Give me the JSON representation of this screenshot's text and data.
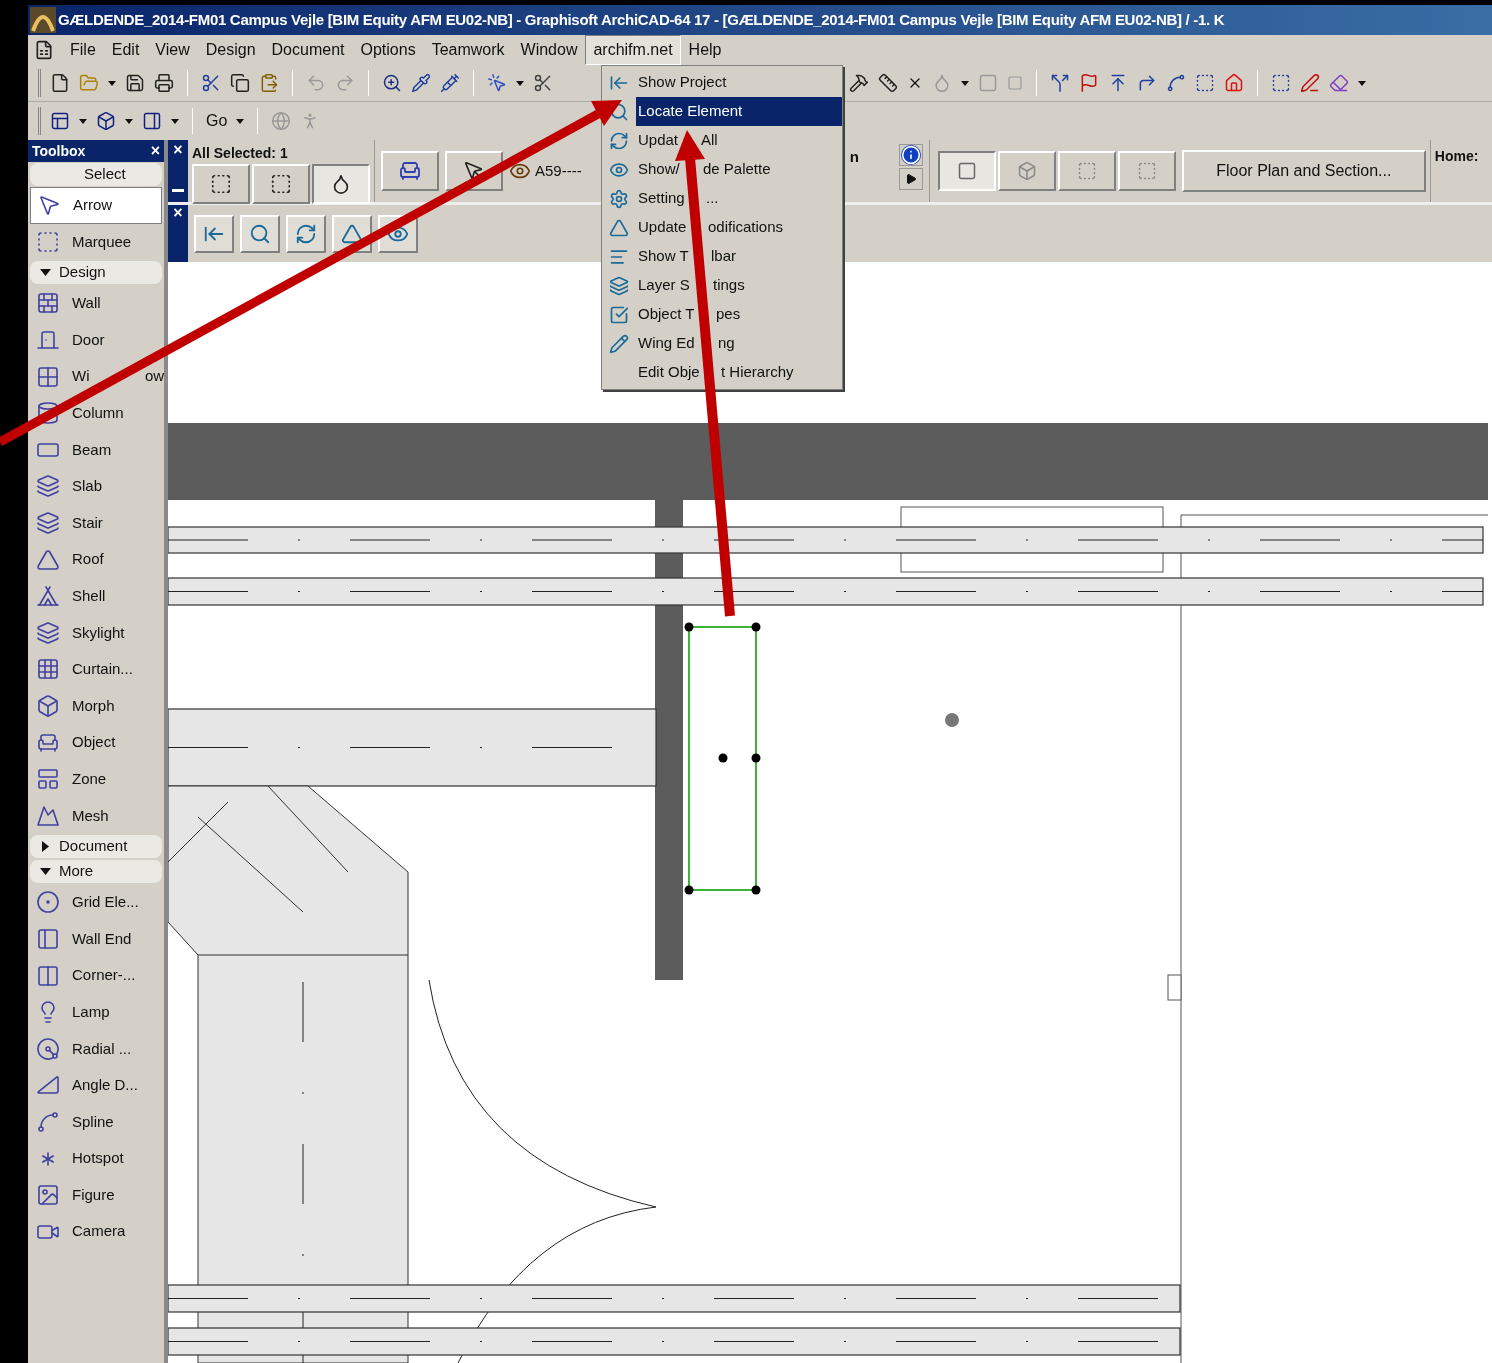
{
  "window": {
    "title": "GÆLDENDE_2014-FM01 Campus Vejle  [BIM Equity AFM EU02-NB] - Graphisoft ArchiCAD-64 17 - [GÆLDENDE_2014-FM01 Campus Vejle  [BIM Equity AFM EU02-NB] / -1. K"
  },
  "menu_bar": [
    {
      "label": "File",
      "selected": false
    },
    {
      "label": "Edit",
      "selected": false
    },
    {
      "label": "View",
      "selected": false
    },
    {
      "label": "Design",
      "selected": false
    },
    {
      "label": "Document",
      "selected": false
    },
    {
      "label": "Options",
      "selected": false
    },
    {
      "label": "Teamwork",
      "selected": false
    },
    {
      "label": "Window",
      "selected": false
    },
    {
      "label": "archifm.net",
      "selected": true
    },
    {
      "label": "Help",
      "selected": false
    }
  ],
  "toolbar": {
    "go_label": "Go"
  },
  "dropdown_menu": [
    {
      "label": "Show Project",
      "selected": false
    },
    {
      "label": "Locate Element",
      "selected": true
    },
    {
      "label_parts": [
        "Updat",
        "All"
      ],
      "selected": false
    },
    {
      "label_parts": [
        "Show/",
        "de Palette"
      ],
      "selected": false
    },
    {
      "label_parts": [
        "Setting",
        "..."
      ],
      "selected": false
    },
    {
      "label_parts": [
        "Update",
        "odifications"
      ],
      "selected": false
    },
    {
      "label_parts": [
        "Show T",
        "lbar"
      ],
      "selected": false
    },
    {
      "label_parts": [
        "Layer S",
        "tings"
      ],
      "selected": false
    },
    {
      "label_parts": [
        "Object T",
        "pes"
      ],
      "selected": false
    },
    {
      "label_parts": [
        "Wing Ed",
        "ng"
      ],
      "selected": false
    },
    {
      "label_parts": [
        "Edit Obje",
        "t Hierarchy"
      ],
      "selected": false
    }
  ],
  "toolbox": {
    "title": "Toolbox",
    "close": "×",
    "sections": [
      {
        "label": "Select",
        "kind": "plain",
        "items": [
          {
            "label": "Arrow",
            "selected": true
          },
          {
            "label": "Marquee",
            "selected": false
          }
        ]
      },
      {
        "label": "Design",
        "kind": "collapsible",
        "expanded": true,
        "items": [
          {
            "label": "Wall",
            "selected": false
          },
          {
            "label": "Door",
            "selected": false
          },
          {
            "label_parts": [
              "Wi",
              "ow"
            ],
            "selected": false
          },
          {
            "label": "Column",
            "selected": false
          },
          {
            "label": "Beam",
            "selected": false
          },
          {
            "label": "Slab",
            "selected": false
          },
          {
            "label": "Stair",
            "selected": false
          },
          {
            "label": "Roof",
            "selected": false
          },
          {
            "label": "Shell",
            "selected": false
          },
          {
            "label": "Skylight",
            "selected": false
          },
          {
            "label": "Curtain...",
            "selected": false
          },
          {
            "label": "Morph",
            "selected": false
          },
          {
            "label": "Object",
            "selected": false
          },
          {
            "label": "Zone",
            "selected": false
          },
          {
            "label": "Mesh",
            "selected": false
          }
        ]
      },
      {
        "label": "Document",
        "kind": "collapsible",
        "expanded": false
      },
      {
        "label": "More",
        "kind": "collapsible",
        "expanded": true,
        "items": [
          {
            "label": "Grid Ele...",
            "selected": false
          },
          {
            "label": "Wall End",
            "selected": false
          },
          {
            "label": "Corner-...",
            "selected": false
          },
          {
            "label": "Lamp",
            "selected": false
          },
          {
            "label": "Radial ...",
            "selected": false
          },
          {
            "label": "Angle D...",
            "selected": false
          },
          {
            "label": "Spline",
            "selected": false
          },
          {
            "label": "Hotspot",
            "selected": false
          },
          {
            "label": "Figure",
            "selected": false
          },
          {
            "label": "Camera",
            "selected": false
          }
        ]
      }
    ]
  },
  "info_box": {
    "close": "×",
    "title": "All Selected: 1",
    "layer": "A59----",
    "fragment": "n",
    "view_button": "Floor Plan and Section...",
    "home": "Home:"
  },
  "archifm_palette": {
    "close": "×"
  }
}
